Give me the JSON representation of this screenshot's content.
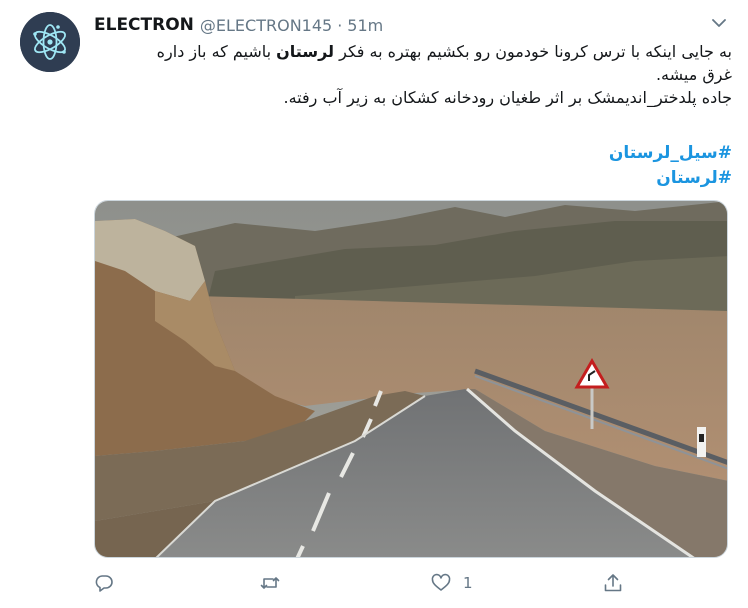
{
  "tweet": {
    "author_name": "ELECTRON",
    "author_handle": "@ELECTRON145",
    "separator": "·",
    "time": "51m",
    "text_line1_before": "به جایی اینکه با ترس کرونا خودمون رو بکشیم بهتره به فکر ",
    "text_line1_bold": "لرستان",
    "text_line1_after": " باشیم که باز داره",
    "text_line2": "غرق میشه.",
    "text_line3": "جاده پلدختر_اندیمشک بر اثر طغیان رودخانه کشکان به زیر آب رفته.",
    "hashtags": [
      "#سیل_لرستان",
      "#لرستان"
    ]
  },
  "actions": {
    "reply_count": "",
    "retweet_count": "",
    "like_count": "1",
    "share_count": ""
  },
  "icons": {
    "avatar": "atom-logo",
    "caret": "chevron-down-icon",
    "reply": "reply-icon",
    "retweet": "retweet-icon",
    "like": "heart-icon",
    "share": "share-icon"
  },
  "colors": {
    "link": "#1b95e0",
    "secondary": "#657786"
  }
}
